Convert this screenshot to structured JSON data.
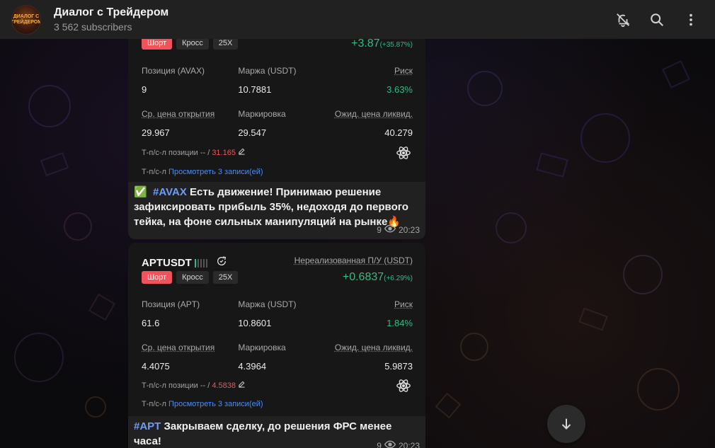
{
  "header": {
    "avatar_text": "ДИАЛОГ С ТРЕЙДЕРОМ",
    "title": "Диалог с Трейдером",
    "subscribers": "3 562 subscribers",
    "icons": [
      "mute-bell-icon",
      "search-icon",
      "more-vertical-icon"
    ]
  },
  "messages": [
    {
      "tags": [
        "Шорт",
        "Кросс",
        "25X"
      ],
      "pnl": "+3.87",
      "pnl_pct": "(+35.87%)",
      "row1": {
        "labels": [
          "Позиция (AVAX)",
          "Маржа (USDT)",
          "Риск"
        ],
        "values": [
          "9",
          "10.7881",
          "3.63%"
        ]
      },
      "row2": {
        "labels": [
          "Ср. цена открытия",
          "Маркировка",
          "Ожид. цена ликвид."
        ],
        "values": [
          "29.967",
          "29.547",
          "40.279"
        ]
      },
      "tp_label": "Т-п/с-л позиции -- / ",
      "tp_value": "31.165",
      "tp2_label": "Т-п/с-л",
      "tp2_link": "Просмотреть 3 записи(ей)",
      "caption_check": "✅",
      "caption_tag": "#AVAX",
      "caption_text": "Есть движение! Принимаю решение зафиксировать прибыль 35%, недоходя до первого тейка, на фоне сильных манипуляций на рынке🔥",
      "views": "9",
      "time": "20:23"
    },
    {
      "pair": "APTUSDT",
      "pnl_label": "Нереализованная П/У (USDT)",
      "tags": [
        "Шорт",
        "Кросс",
        "25X"
      ],
      "pnl": "+0.6837",
      "pnl_pct": "(+6.29%)",
      "row1": {
        "labels": [
          "Позиция (APT)",
          "Маржа (USDT)",
          "Риск"
        ],
        "values": [
          "61.6",
          "10.8601",
          "1.84%"
        ]
      },
      "row2": {
        "labels": [
          "Ср. цена открытия",
          "Маркировка",
          "Ожид. цена ликвид."
        ],
        "values": [
          "4.4075",
          "4.3964",
          "5.9873"
        ]
      },
      "tp_label": "Т-п/с-л позиции -- / ",
      "tp_value": "4.5838",
      "tp2_label": "Т-п/с-л",
      "tp2_link": "Просмотреть 3 записи(ей)",
      "caption_tag": "#APT",
      "caption_text": "Закрываем сделку, до решения ФРС менее часа!",
      "views": "9",
      "time": "20:23"
    }
  ],
  "colors": {
    "accent_green": "#2ebd85",
    "short_red": "#f0545a",
    "link_blue": "#4c8cf5",
    "header_bg": "#212121"
  }
}
